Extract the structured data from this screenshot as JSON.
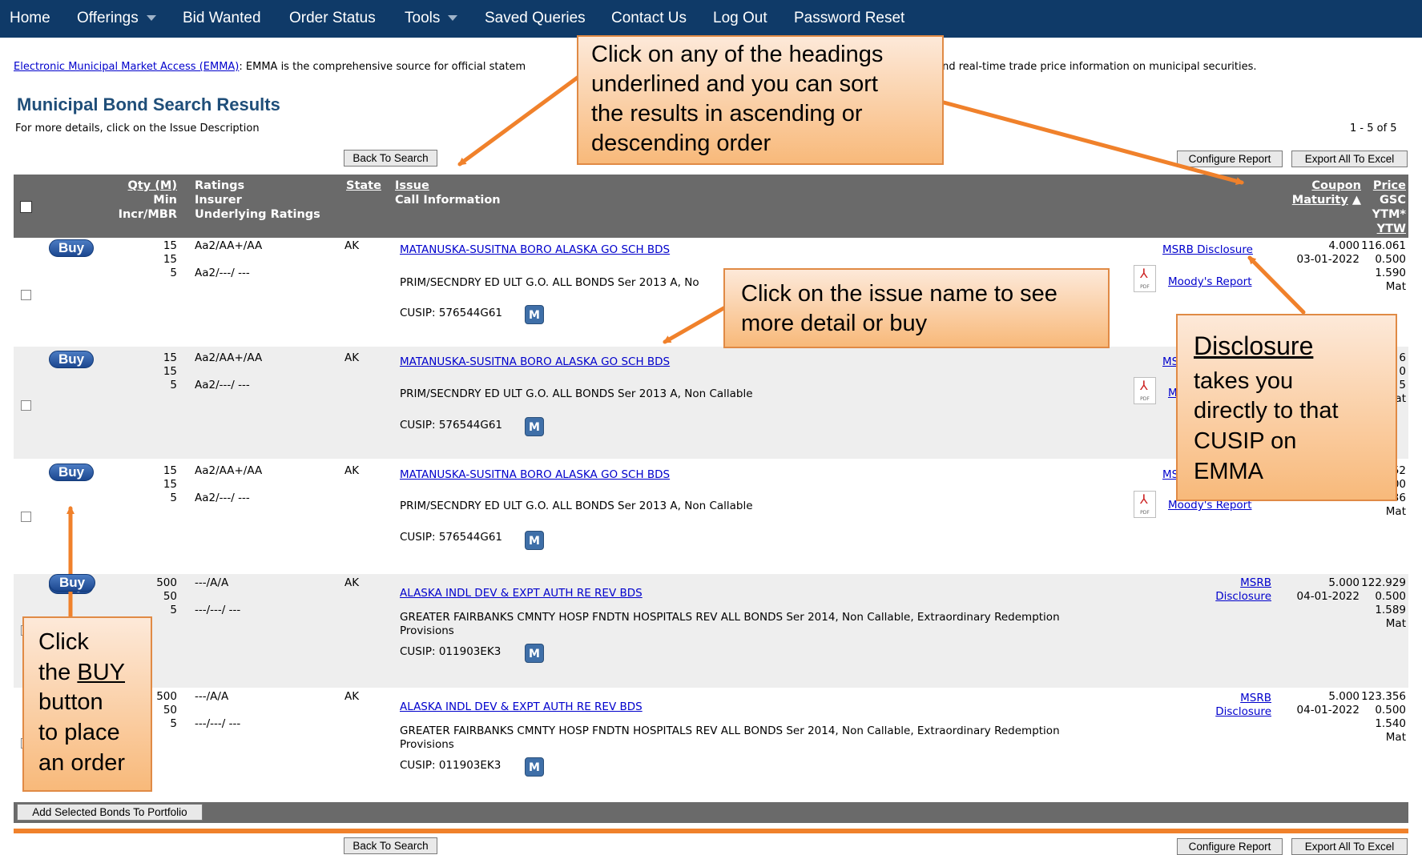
{
  "nav": {
    "items": [
      "Home",
      "Offerings",
      "Bid Wanted",
      "Order Status",
      "Tools",
      "Saved Queries",
      "Contact Us",
      "Log Out",
      "Password Reset"
    ]
  },
  "intro": {
    "link": "Electronic Municipal Market Access (EMMA)",
    "text_start": ": EMMA is the comprehensive source for official statem",
    "text_end": "ments and real-time trade price information on municipal securities."
  },
  "page": {
    "title": "Municipal Bond Search Results",
    "subtitle": "For more details, click on the Issue Description",
    "count": "1 - 5 of 5"
  },
  "buttons": {
    "back_to_search": "Back To Search",
    "configure_report": "Configure Report",
    "export_all": "Export All To Excel",
    "add_selected": "Add Selected Bonds To Portfolio"
  },
  "table": {
    "headers": {
      "qty": "Qty (M)",
      "min": "Min",
      "incr": "Incr/MBR",
      "ratings": "Ratings",
      "insurer": "Insurer",
      "underlying": "Underlying Ratings",
      "state": "State",
      "issue": "Issue",
      "call_info": "Call Information",
      "coupon": "Coupon",
      "maturity": "Maturity",
      "sort_indicator": "▲",
      "price": "Price",
      "gsc": "GSC",
      "ytm": "YTM*",
      "ytw": "YTW"
    },
    "buy_label": "Buy",
    "rows": [
      {
        "qty": "15",
        "min": "15",
        "incr": "5",
        "rating": "Aa2/AA+/AA",
        "underlying": "Aa2/---/ ---",
        "state": "AK",
        "issue": "MATANUSKA-SUSITNA BORO ALASKA GO SCH BDS",
        "call_info": "PRIM/SECNDRY ED ULT G.O. ALL BONDS Ser 2013 A, No",
        "cusip": "CUSIP: 576544G61",
        "m": "M",
        "disclosure": "MSRB Disclosure",
        "report": "Moody's Report",
        "coupon": "4.000",
        "maturity": "03-01-2022",
        "price": "116.061",
        "gsc": "0.500",
        "ytm": "1.590",
        "ytw": "Mat"
      },
      {
        "qty": "15",
        "min": "15",
        "incr": "5",
        "rating": "Aa2/AA+/AA",
        "underlying": "Aa2/---/ ---",
        "state": "AK",
        "issue": "MATANUSKA-SUSITNA BORO ALASKA GO SCH BDS",
        "call_info": "PRIM/SECNDRY ED ULT G.O. ALL BONDS Ser 2013 A, Non Callable",
        "cusip": "CUSIP: 576544G61",
        "m": "M",
        "disclosure": "MS",
        "report": "M",
        "price": "6",
        "gsc": "0",
        "ytm": "5",
        "ytw": "at"
      },
      {
        "qty": "15",
        "min": "15",
        "incr": "5",
        "rating": "Aa2/AA+/AA",
        "underlying": "Aa2/---/ ---",
        "state": "AK",
        "issue": "MATANUSKA-SUSITNA BORO ALASKA GO SCH BDS",
        "call_info": "PRIM/SECNDRY ED ULT G.O. ALL BONDS Ser 2013 A, Non Callable",
        "cusip": "CUSIP: 576544G61",
        "m": "M",
        "disclosure": "MS",
        "report": "Moody's Report",
        "price": "52",
        "gsc": "00",
        "ytm": ".36",
        "ytw": "Mat"
      },
      {
        "qty": "500",
        "min": "50",
        "incr": "5",
        "rating": "---/A/A",
        "underlying": "---/---/ ---",
        "state": "AK",
        "issue": "ALASKA INDL DEV & EXPT AUTH RE REV BDS",
        "call_info": "GREATER FAIRBANKS CMNTY HOSP FNDTN HOSPITALS REV ALL BONDS Ser 2014, Non Callable, Extraordinary Redemption",
        "call_info_2": "Provisions",
        "cusip": "CUSIP: 011903EK3",
        "m": "M",
        "disclosure_1": "MSRB",
        "disclosure_2": "Disclosure",
        "coupon": "5.000",
        "maturity": "04-01-2022",
        "price": "122.929",
        "gsc": "0.500",
        "ytm": "1.589",
        "ytw": "Mat"
      },
      {
        "qty": "500",
        "min": "50",
        "incr": "5",
        "rating": "---/A/A",
        "underlying": "---/---/ ---",
        "state": "AK",
        "issue": "ALASKA INDL DEV & EXPT AUTH RE REV BDS",
        "call_info": "GREATER FAIRBANKS CMNTY HOSP FNDTN HOSPITALS REV ALL BONDS Ser 2014, Non Callable, Extraordinary Redemption",
        "call_info_2": "Provisions",
        "cusip": "CUSIP: 011903EK3",
        "m": "M",
        "disclosure_1": "MSRB",
        "disclosure_2": "Disclosure",
        "coupon": "5.000",
        "maturity": "04-01-2022",
        "price": "123.356",
        "gsc": "0.500",
        "ytm": "1.540",
        "ytw": "Mat"
      }
    ]
  },
  "callouts": {
    "sort": [
      "Click on any of the headings",
      "underlined and you can sort",
      "the results in ascending or",
      "descending order"
    ],
    "issue": [
      "Click on the issue name to see",
      "more detail or buy"
    ],
    "disclosure_title": "Disclosure",
    "disclosure": [
      "takes you",
      "directly to that",
      "CUSIP on",
      "EMMA"
    ],
    "buy_1": "Click",
    "buy_2_prefix": "the ",
    "buy_2_link": "BUY",
    "buy_3": "button",
    "buy_4": "to place",
    "buy_5": "an order"
  },
  "colors": {
    "nav": "#0f3a68",
    "header": "#6a6a6a",
    "accent": "#f0812b",
    "link": "#0000cc"
  }
}
